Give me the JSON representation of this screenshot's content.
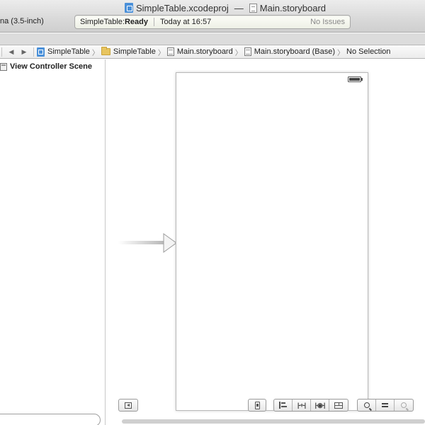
{
  "window": {
    "project_file": "SimpleTable.xcodeproj",
    "title_separator": "—",
    "open_file": "Main.storyboard",
    "scheme_label": "na (3.5-inch)"
  },
  "activity": {
    "status_project": "SimpleTable: ",
    "status_state": "Ready",
    "timestamp": "Today at 16:57",
    "issues": "No Issues"
  },
  "jumpbar": {
    "back_icon": "◀",
    "forward_icon": "▶",
    "crumbs": [
      "SimpleTable",
      "SimpleTable",
      "Main.storyboard",
      "Main.storyboard (Base)",
      "No Selection"
    ],
    "separator": "〉"
  },
  "outline": {
    "scene_label": "View Controller Scene"
  },
  "canvas": {
    "pin_glyph": "|-+-|",
    "resolve_glyph": "|-◉-|"
  },
  "colors": {
    "accent": "#4a90d9",
    "folder": "#e8c560"
  }
}
